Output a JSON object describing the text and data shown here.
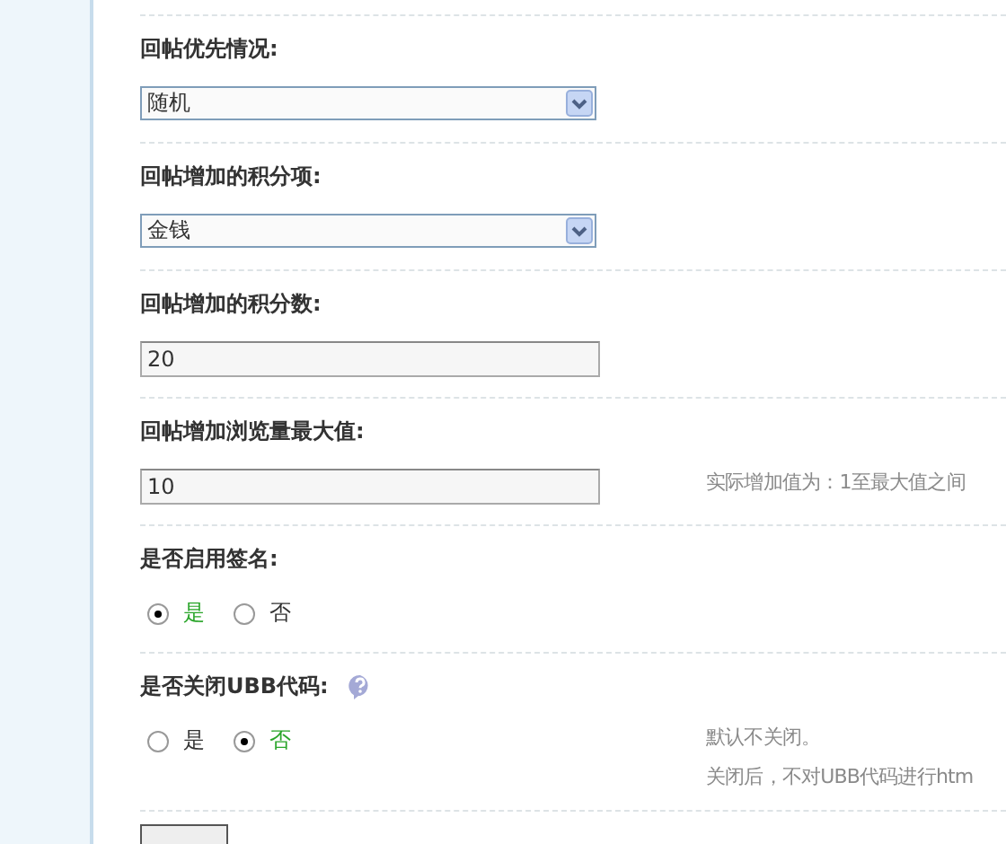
{
  "rows": [
    {
      "kind": "select",
      "label": "回帖优先情况:",
      "value": "随机",
      "hints": []
    },
    {
      "kind": "select",
      "label": "回帖增加的积分项:",
      "value": "金钱",
      "hints": []
    },
    {
      "kind": "text",
      "label": "回帖增加的积分数:",
      "value": "20",
      "hints": []
    },
    {
      "kind": "text",
      "label": "回帖增加浏览量最大值:",
      "value": "10",
      "hints": [
        "实际增加值为：1至最大值之间"
      ]
    },
    {
      "kind": "radio",
      "label": "是否启用签名:",
      "options": [
        {
          "label": "是",
          "selected": true
        },
        {
          "label": "否",
          "selected": false
        }
      ],
      "hints": []
    },
    {
      "kind": "radio",
      "label": "是否关闭UBB代码:",
      "help_icon": true,
      "options": [
        {
          "label": "是",
          "selected": false
        },
        {
          "label": "否",
          "selected": true
        }
      ],
      "hints": [
        "默认不关闭。",
        "关闭后，不对UBB代码进行htm"
      ]
    }
  ]
}
